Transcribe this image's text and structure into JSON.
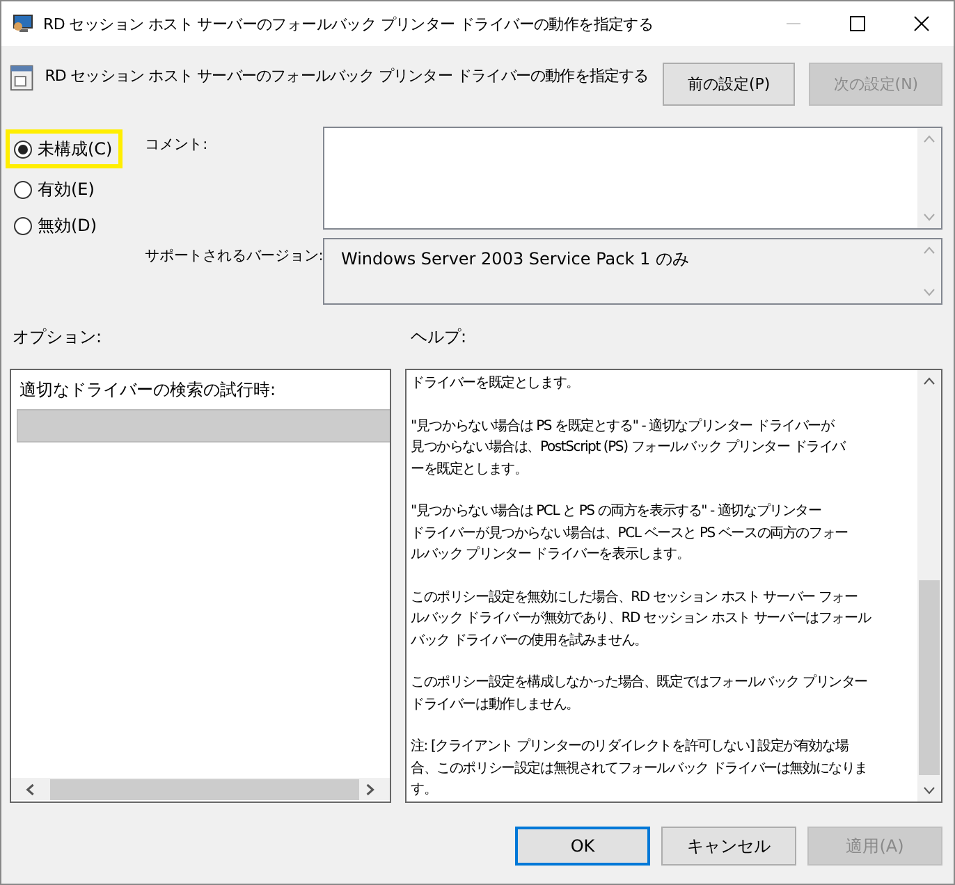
{
  "window": {
    "title": "RD セッション ホスト サーバーのフォールバック プリンター ドライバーの動作を指定する"
  },
  "header": {
    "title": "RD セッション ホスト サーバーのフォールバック プリンター ドライバーの動作を指定する",
    "buttons": [
      {
        "label": "前の設定(P)",
        "disabled": false
      },
      {
        "label": "次の設定(N)",
        "disabled": true
      }
    ]
  },
  "states": [
    {
      "label": "未構成(C)",
      "selected": true,
      "highlighted": true
    },
    {
      "label": "有効(E)",
      "selected": false,
      "highlighted": false
    },
    {
      "label": "無効(D)",
      "selected": false,
      "highlighted": false
    }
  ],
  "comment": {
    "label": "コメント:"
  },
  "supported": {
    "label": "サポートされるバージョン:",
    "value": "Windows Server 2003 Service Pack 1 のみ"
  },
  "options": {
    "label": "オプション:",
    "setting_label": "適切なドライバーの検索の試行時:"
  },
  "help": {
    "label": "ヘルプ:",
    "paragraphs": [
      {
        "lines": [
          "ドライバーを既定とします。"
        ]
      },
      {
        "lines": [
          "\"見つからない場合は PS を既定とする\" - 適切なプリンター ドライバーが",
          "見つからない場合は、PostScript (PS) フォールバック プリンター ドライバ",
          "ーを既定とします。"
        ]
      },
      {
        "lines": [
          "\"見つからない場合は PCL と PS の両方を表示する\" - 適切なプリンター",
          "ドライバーが見つからない場合は、PCL ベースと PS ベースの両方のフォー",
          "ルバック プリンター ドライバーを表示します。"
        ]
      },
      {
        "lines": [
          "このポリシー設定を無効にした場合、RD セッション ホスト サーバー フォー",
          "ルバック ドライバーが無効であり、RD セッション ホスト サーバーはフォール",
          "バック ドライバーの使用を試みません。"
        ]
      },
      {
        "lines": [
          "このポリシー設定を構成しなかった場合、既定ではフォールバック プリンター",
          "ドライバーは動作しません。"
        ]
      },
      {
        "lines": [
          "注: [クライアント プリンターのリダイレクトを許可しない] 設定が有効な場",
          "合、このポリシー設定は無視されてフォールバック ドライバーは無効になりま",
          "す。"
        ]
      }
    ]
  },
  "footer": {
    "buttons": [
      {
        "label": "OK",
        "disabled": false,
        "default": true
      },
      {
        "label": "キャンセル",
        "disabled": false,
        "default": false
      },
      {
        "label": "適用(A)",
        "disabled": true,
        "default": false
      }
    ]
  }
}
